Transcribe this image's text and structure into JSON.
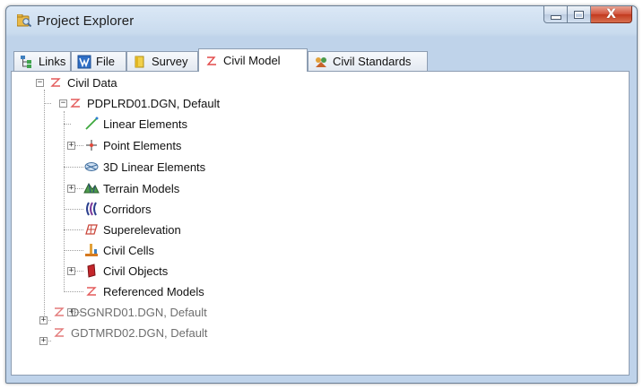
{
  "window": {
    "title": "Project Explorer",
    "app_icon": "project-explorer-icon",
    "controls": {
      "minimize": "minimize-icon",
      "maximize": "maximize-icon",
      "close": "close-icon",
      "close_glyph": "X"
    }
  },
  "tabs": [
    {
      "label": "Links",
      "icon": "links-icon",
      "active": false
    },
    {
      "label": "File",
      "icon": "file-icon",
      "active": false
    },
    {
      "label": "Survey",
      "icon": "survey-icon",
      "active": false
    },
    {
      "label": "Civil Model",
      "icon": "civil-model-icon",
      "active": true
    },
    {
      "label": "Civil Standards",
      "icon": "civil-standards-icon",
      "active": false
    }
  ],
  "tree": {
    "root": {
      "label": "Civil Data",
      "icon": "civil-model-icon",
      "expander": "−"
    },
    "model1": {
      "label": "PDPLRD01.DGN, Default",
      "icon": "civil-model-icon",
      "expander": "−"
    },
    "children": [
      {
        "label": "Linear Elements",
        "icon": "linear-element-icon",
        "expander": "+"
      },
      {
        "label": "Point Elements",
        "icon": "point-element-icon",
        "expander": ""
      },
      {
        "label": "3D Linear Elements",
        "icon": "3d-linear-element-icon",
        "expander": "+"
      },
      {
        "label": "Terrain Models",
        "icon": "terrain-model-icon",
        "expander": ""
      },
      {
        "label": "Corridors",
        "icon": "corridor-icon",
        "expander": ""
      },
      {
        "label": "Superelevation",
        "icon": "superelevation-icon",
        "expander": ""
      },
      {
        "label": "Civil Cells",
        "icon": "civil-cell-icon",
        "expander": "+"
      },
      {
        "label": "Civil Objects",
        "icon": "civil-object-icon",
        "expander": ""
      },
      {
        "label": "Referenced Models",
        "icon": "civil-model-icon",
        "expander": "+"
      }
    ],
    "model2": {
      "label": "DSGNRD01.DGN, Default",
      "icon": "civil-model-icon",
      "expander": "+"
    },
    "model3": {
      "label": "GDTMRD02.DGN, Default",
      "icon": "civil-model-icon",
      "expander": "+"
    }
  }
}
